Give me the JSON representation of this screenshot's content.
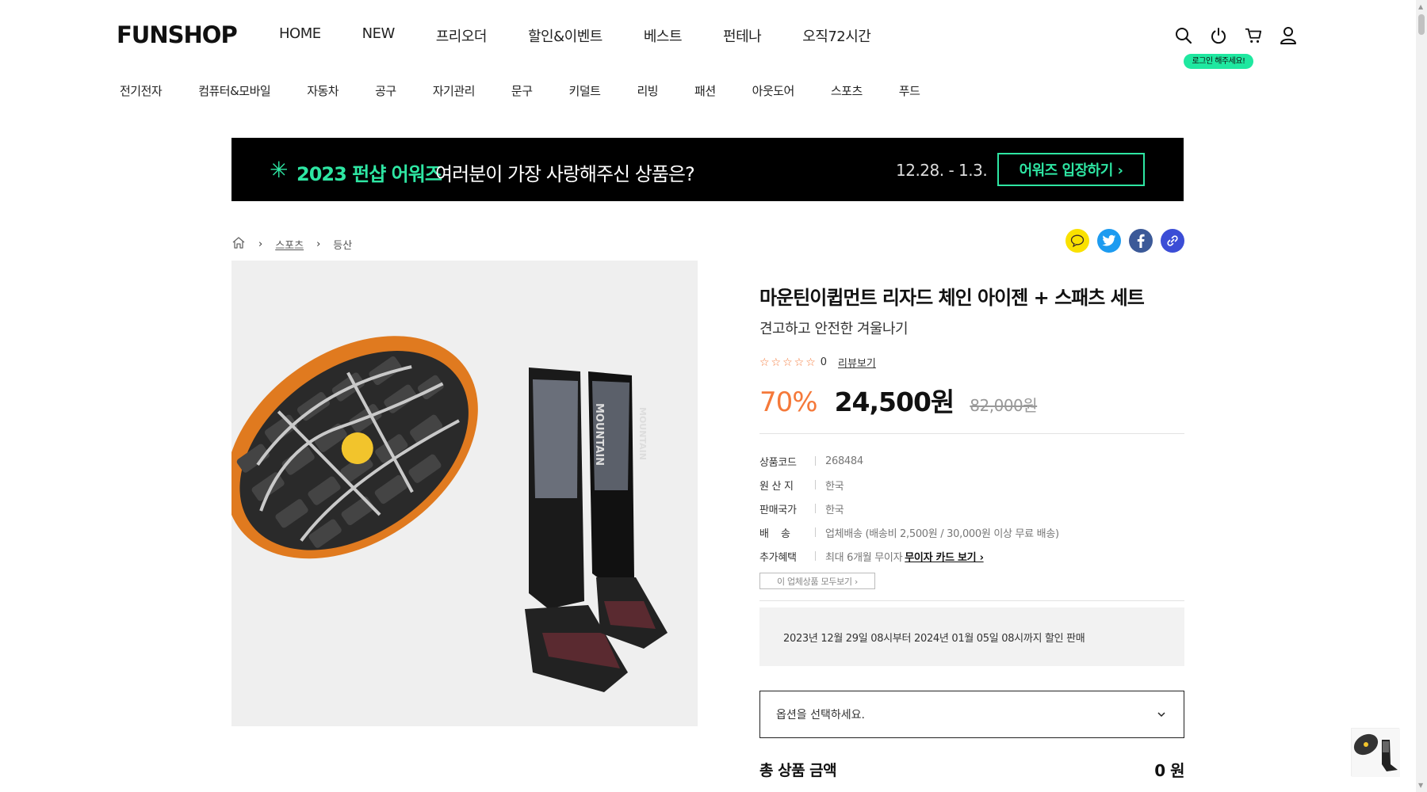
{
  "header": {
    "logo": "FUNSHOP",
    "main_nav": [
      "HOME",
      "NEW",
      "프리오더",
      "할인&이벤트",
      "베스트",
      "펀테나",
      "오직72시간"
    ],
    "icons": [
      "search-icon",
      "power-icon",
      "cart-icon",
      "user-icon"
    ],
    "login_tip": "로그인 해주세요!"
  },
  "category_nav": [
    "전기전자",
    "컴퓨터&모바일",
    "자동차",
    "공구",
    "자기관리",
    "문구",
    "키덜트",
    "리빙",
    "패션",
    "아웃도어",
    "스포츠",
    "푸드"
  ],
  "banner": {
    "star": "✳",
    "title_green": "2023 펀샵 어워즈",
    "title_white": "여러분이 가장 사랑해주신 상품은?",
    "date": "12.28. - 1.3.",
    "button": "어워즈 입장하기 ›"
  },
  "breadcrumb": {
    "home_icon": "home-icon",
    "items": [
      "스포츠",
      "등산"
    ],
    "separator": "›"
  },
  "share": [
    "chat-icon",
    "twitter-icon",
    "facebook-icon",
    "link-icon"
  ],
  "product": {
    "title": "마운틴이큅먼트 리자드 체인 아이젠 + 스패츠 세트",
    "subtitle": "견고하고 안전한 겨울나기",
    "stars": "☆☆☆☆☆",
    "rating_value": 0,
    "review_count": "0",
    "review_link": "리뷰보기",
    "discount": "70%",
    "price": "24,500원",
    "original_price": "82,000원",
    "specs": [
      {
        "key": "상품코드",
        "value": "268484"
      },
      {
        "key": "원 산 지",
        "value": "한국"
      },
      {
        "key": "판매국가",
        "value": "한국"
      },
      {
        "key": "배    송",
        "value": "업체배송 (배송비 2,500원 / 30,000원 이상 무료 배송)"
      },
      {
        "key": "추가혜택",
        "value": "최대 6개월 무이자",
        "link": "무이자 카드 보기 ›"
      }
    ],
    "see_all": "이 업체상품 모두보기 ›",
    "sale_period": "2023년 12월 29일 08시부터 2024년 01월 05일 08시까지 할인 판매",
    "option_placeholder": "옵션을 선택하세요.",
    "total_label": "총 상품 금액",
    "total_amount": "0 원"
  },
  "colors": {
    "accent_orange": "#f5793a",
    "accent_green": "#2ee6a3",
    "banner_bg": "#000000"
  }
}
